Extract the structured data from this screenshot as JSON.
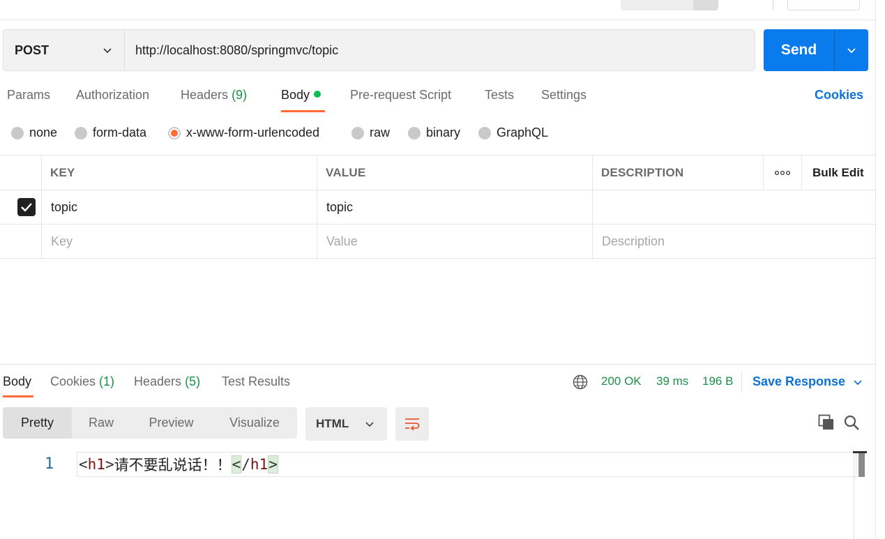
{
  "request": {
    "method": "POST",
    "url": "http://localhost:8080/springmvc/topic",
    "send_label": "Send"
  },
  "request_tabs": {
    "params": "Params",
    "authorization": "Authorization",
    "headers": "Headers",
    "headers_count": "(9)",
    "body": "Body",
    "pre_request": "Pre-request Script",
    "tests": "Tests",
    "settings": "Settings",
    "cookies": "Cookies"
  },
  "body_types": {
    "none": "none",
    "form_data": "form-data",
    "urlencoded": "x-www-form-urlencoded",
    "raw": "raw",
    "binary": "binary",
    "graphql": "GraphQL",
    "selected": "x-www-form-urlencoded"
  },
  "params_table": {
    "headers": {
      "key": "KEY",
      "value": "VALUE",
      "description": "DESCRIPTION",
      "more": "ooo",
      "bulk_edit": "Bulk Edit"
    },
    "rows": [
      {
        "checked": true,
        "key": "topic",
        "value": "topic",
        "description": ""
      }
    ],
    "placeholders": {
      "key": "Key",
      "value": "Value",
      "description": "Description"
    }
  },
  "response": {
    "tabs": {
      "body": "Body",
      "cookies": "Cookies",
      "cookies_count": "(1)",
      "headers": "Headers",
      "headers_count": "(5)",
      "test_results": "Test Results"
    },
    "status": "200 OK",
    "time": "39 ms",
    "size": "196 B",
    "save_response": "Save Response",
    "views": {
      "pretty": "Pretty",
      "raw": "Raw",
      "preview": "Preview",
      "visualize": "Visualize"
    },
    "format": "HTML",
    "code": {
      "line_number": "1",
      "open_tag_lt": "<",
      "open_tag_name": "h1",
      "open_tag_gt": ">",
      "text": "请不要乱说话！！",
      "close_tag_lt": "<",
      "close_tag_slash": "/",
      "close_tag_name": "h1",
      "close_tag_gt": ">"
    }
  },
  "colors": {
    "accent_orange": "#ff6c37",
    "send_blue": "#097bed",
    "link_blue": "#0b72d6",
    "status_green": "#1a8f4a"
  }
}
